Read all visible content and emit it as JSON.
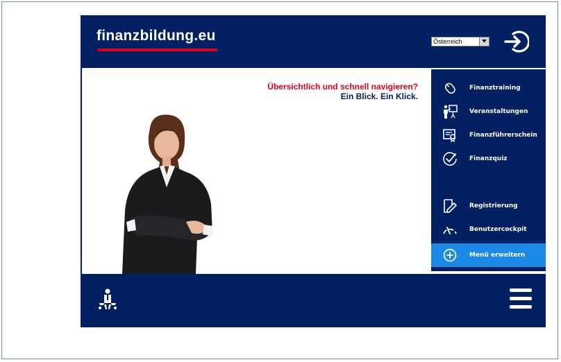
{
  "header": {
    "logo_text": "finanzbildung.eu",
    "country_select": {
      "value": "Österreich"
    }
  },
  "hero": {
    "headline_red": "Übersichtlich und schnell navigieren?",
    "headline_blue": "Ein Blick. Ein Klick."
  },
  "menu": {
    "items": [
      {
        "label": "Finanztraining",
        "icon": "mouse-icon"
      },
      {
        "label": "Veranstaltungen",
        "icon": "presentation-icon"
      },
      {
        "label": "Finanzführerschein",
        "icon": "certificate-icon"
      },
      {
        "label": "Finanzquiz",
        "icon": "checkmark-circle-icon"
      },
      {
        "label": "Registrierung",
        "icon": "form-pen-icon"
      },
      {
        "label": "Benutzercockpit",
        "icon": "gauge-icon"
      },
      {
        "label": "Menü erweitern",
        "icon": "plus-circle-icon"
      }
    ]
  },
  "colors": {
    "navy": "#032062",
    "red": "#e2001a",
    "active_blue": "#1a8ae6"
  }
}
